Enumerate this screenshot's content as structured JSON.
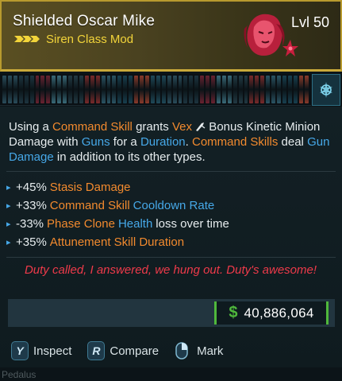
{
  "item": {
    "name": "Shielded Oscar Mike",
    "level": "Lvl 50",
    "type": "Siren Class Mod"
  },
  "description": {
    "t1": "Using a ",
    "t2": "Command Skill",
    "t3": " grants ",
    "t4": "Vex",
    "t5": " ",
    "t6": " Bonus Kinetic Minion Damage with ",
    "t7": "Guns",
    "t8": " for a ",
    "t9": "Duration",
    "t10": ". ",
    "t11": "Command Skills",
    "t12": " deal ",
    "t13": "Gun Damage",
    "t14": " in addition to its other types."
  },
  "stats": [
    {
      "value": "+45%",
      "name": "Stasis Damage"
    },
    {
      "value": "+33%",
      "name": "Command Skill",
      "extra": "Cooldown Rate"
    },
    {
      "value": "-33%",
      "name": "Phase Clone",
      "extra": "Health",
      "suffix": "loss over time"
    },
    {
      "value": "+35%",
      "name": "Attunement Skill Duration"
    }
  ],
  "flavor": "Duty called, I answered, we hung out. Duty's awesome!",
  "price": {
    "symbol": "$",
    "value": "40,886,064"
  },
  "actions": [
    {
      "key": "Y",
      "label": "Inspect"
    },
    {
      "key": "R",
      "label": "Compare"
    },
    {
      "key": "",
      "label": "Mark"
    }
  ],
  "footer": "Pedalus",
  "colors": {
    "rarity": "#f2d43a",
    "orange_highlight": "#f28a2e",
    "blue_highlight": "#46a8e8",
    "flavor": "#ee3a4a",
    "price_accent": "#4fb83c",
    "header_border": "#b89a2e"
  },
  "icons": {
    "rarity": "chevron-stripes-icon",
    "portrait": "siren-portrait-icon",
    "class_badge": "siren-class-icon",
    "vex_minion": "minion-glyph-icon",
    "mark": "mouse-right-icon"
  }
}
